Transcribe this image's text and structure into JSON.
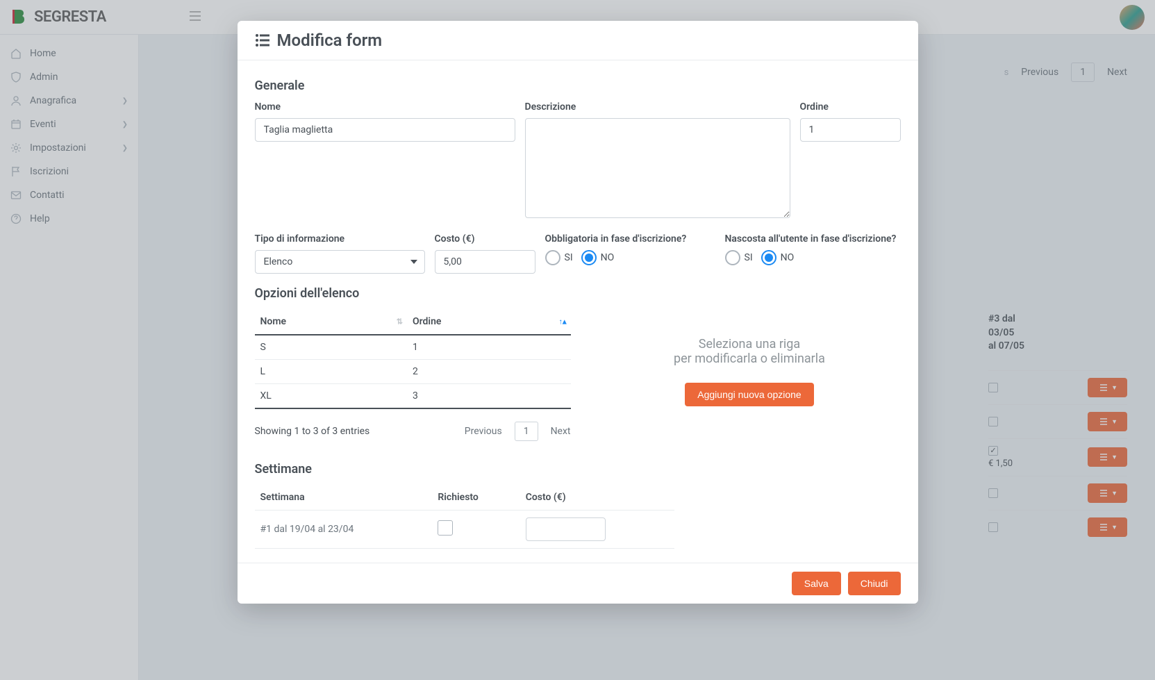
{
  "brand": "SEGRESTA",
  "sidebar": {
    "items": [
      {
        "label": "Home"
      },
      {
        "label": "Admin"
      },
      {
        "label": "Anagrafica",
        "hasChildren": true
      },
      {
        "label": "Eventi",
        "hasChildren": true
      },
      {
        "label": "Impostazioni",
        "hasChildren": true
      },
      {
        "label": "Iscrizioni"
      },
      {
        "label": "Contatti"
      },
      {
        "label": "Help"
      }
    ]
  },
  "bg": {
    "prev": "Previous",
    "page": "1",
    "next": "Next",
    "weekHeadL1": "#3 dal",
    "weekHeadL2": "03/05",
    "weekHeadL3": "al 07/05",
    "row3cost": "€ 1,50"
  },
  "modal": {
    "title": "Modifica form",
    "sectionGeneral": "Generale",
    "labels": {
      "nome": "Nome",
      "descrizione": "Descrizione",
      "ordine": "Ordine",
      "tipo": "Tipo di informazione",
      "costo": "Costo (€)",
      "obblig": "Obbligatoria in fase d'iscrizione?",
      "nascosta": "Nascosta all'utente in fase d'iscrizione?"
    },
    "values": {
      "nome": "Taglia maglietta",
      "descrizione": "",
      "ordine": "1",
      "tipo": "Elenco",
      "costo": "5,00"
    },
    "radio": {
      "si": "SI",
      "no": "NO"
    },
    "sectionOptions": "Opzioni dell'elenco",
    "optionsTable": {
      "headers": {
        "nome": "Nome",
        "ordine": "Ordine"
      },
      "rows": [
        {
          "nome": "S",
          "ordine": "1"
        },
        {
          "nome": "L",
          "ordine": "2"
        },
        {
          "nome": "XL",
          "ordine": "3"
        }
      ],
      "showing": "Showing 1 to 3 of 3 entries",
      "prev": "Previous",
      "page": "1",
      "next": "Next"
    },
    "helper": {
      "line1": "Seleziona una riga",
      "line2": "per modificarla o eliminarla",
      "addBtn": "Aggiungi nuova opzione"
    },
    "sectionWeeks": "Settimane",
    "weeksTable": {
      "headers": {
        "settimana": "Settimana",
        "richiesto": "Richiesto",
        "costo": "Costo (€)"
      },
      "rows": [
        {
          "settimana": "#1 dal 19/04 al 23/04"
        }
      ]
    },
    "footer": {
      "save": "Salva",
      "close": "Chiudi"
    }
  }
}
